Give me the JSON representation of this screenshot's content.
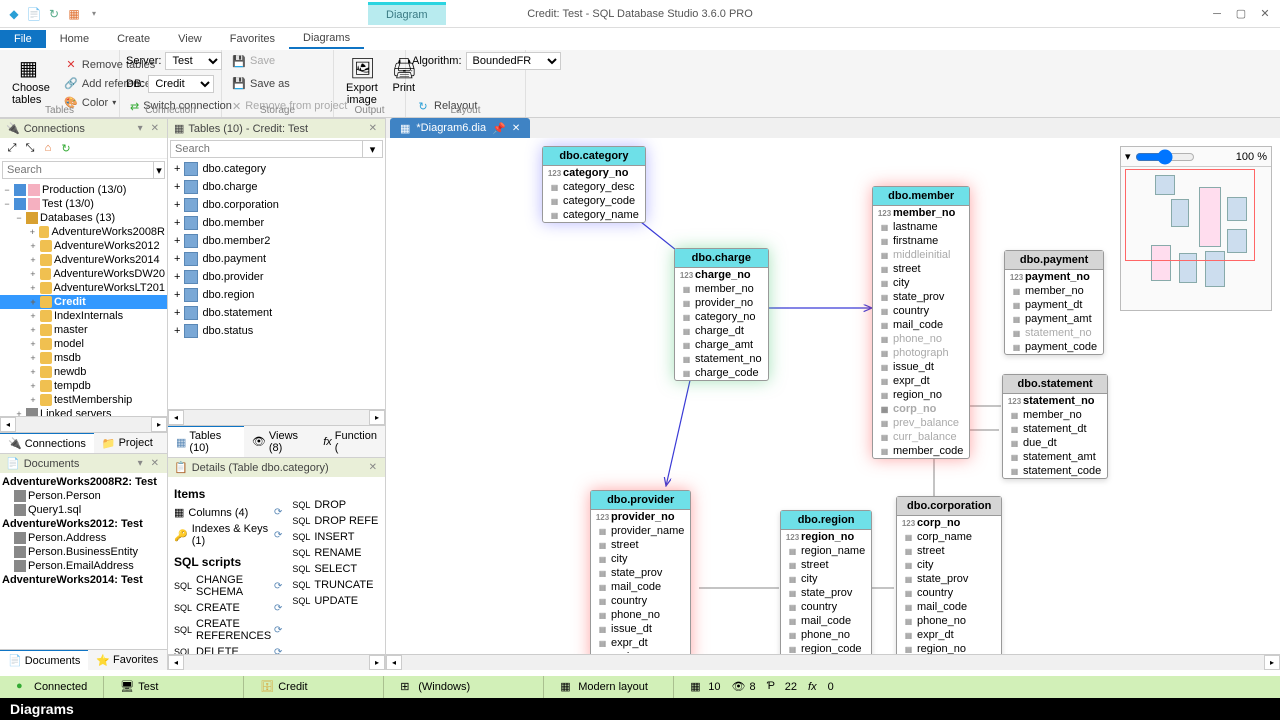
{
  "title": "Credit: Test - SQL Database Studio 3.6.0 PRO",
  "context_tab": "Diagram",
  "ribbon_tabs": {
    "file": "File",
    "home": "Home",
    "create": "Create",
    "view": "View",
    "favorites": "Favorites",
    "diagrams": "Diagrams"
  },
  "ribbon": {
    "choose_tables": "Choose tables",
    "remove_tables": "Remove tables",
    "add_refs": "Add references",
    "color": "Color",
    "server": "Server:",
    "server_val": "Test",
    "db": "DB:",
    "db_val": "Credit",
    "switch_conn": "Switch connection",
    "save": "Save",
    "saveas": "Save as",
    "remove_proj": "Remove from project",
    "export": "Export image",
    "print": "Print",
    "algorithm": "Algorithm:",
    "algo_val": "BoundedFR",
    "relayout": "Relayout",
    "g_tables": "Tables",
    "g_conn": "Connection",
    "g_storage": "Storage",
    "g_output": "Output",
    "g_layout": "Layout"
  },
  "panels": {
    "connections": "Connections",
    "tables_hd": "Tables (10) - Credit: Test",
    "documents": "Documents",
    "details": "Details (Table dbo.category)",
    "search": "Search",
    "tabs_bottom": {
      "tables": "Tables (10)",
      "views": "Views (8)",
      "function": "Function (",
      "connections": "Connections",
      "project": "Project",
      "documents": "Documents",
      "favorites": "Favorites"
    }
  },
  "tree": {
    "prod": "Production (13/0)",
    "test": "Test (13/0)",
    "databases": "Databases (13)",
    "dbs": [
      "AdventureWorks2008R",
      "AdventureWorks2012",
      "AdventureWorks2014",
      "AdventureWorksDW20",
      "AdventureWorksLT201",
      "Credit",
      "IndexInternals",
      "master",
      "model",
      "msdb",
      "newdb",
      "tempdb",
      "testMembership"
    ],
    "linked": "Linked servers"
  },
  "table_list": [
    "dbo.category",
    "dbo.charge",
    "dbo.corporation",
    "dbo.member",
    "dbo.member2",
    "dbo.payment",
    "dbo.provider",
    "dbo.region",
    "dbo.statement",
    "dbo.status"
  ],
  "details": {
    "items": "Items",
    "columns": "Columns (4)",
    "indexes": "Indexes & Keys (1)",
    "sql_scripts": "SQL scripts",
    "change_schema": "CHANGE SCHEMA",
    "create": "CREATE",
    "create_ref": "CREATE REFERENCES",
    "delete": "DELETE",
    "drop": "DROP",
    "drop_ref": "DROP REFE",
    "insert": "INSERT",
    "rename": "RENAME",
    "select": "SELECT",
    "truncate": "TRUNCATE",
    "update": "UPDATE"
  },
  "documents": {
    "g1": "AdventureWorks2008R2: Test",
    "g1_items": [
      "Person.Person",
      "Query1.sql"
    ],
    "g2": "AdventureWorks2012: Test",
    "g2_items": [
      "Person.Address",
      "Person.BusinessEntity",
      "Person.EmailAddress"
    ],
    "g3": "AdventureWorks2014: Test"
  },
  "doc_tab": "*Diagram6.dia",
  "diagram": {
    "category": {
      "name": "dbo.category",
      "cols": [
        "category_no",
        "category_desc",
        "category_code",
        "category_name"
      ]
    },
    "charge": {
      "name": "dbo.charge",
      "cols": [
        "charge_no",
        "member_no",
        "provider_no",
        "category_no",
        "charge_dt",
        "charge_amt",
        "statement_no",
        "charge_code"
      ]
    },
    "member": {
      "name": "dbo.member",
      "cols": [
        "member_no",
        "lastname",
        "firstname",
        "middleinitial",
        "street",
        "city",
        "state_prov",
        "country",
        "mail_code",
        "phone_no",
        "photograph",
        "issue_dt",
        "expr_dt",
        "region_no",
        "corp_no",
        "prev_balance",
        "curr_balance",
        "member_code"
      ]
    },
    "payment": {
      "name": "dbo.payment",
      "cols": [
        "payment_no",
        "member_no",
        "payment_dt",
        "payment_amt",
        "statement_no",
        "payment_code"
      ]
    },
    "statement": {
      "name": "dbo.statement",
      "cols": [
        "statement_no",
        "member_no",
        "statement_dt",
        "due_dt",
        "statement_amt",
        "statement_code"
      ]
    },
    "provider": {
      "name": "dbo.provider",
      "cols": [
        "provider_no",
        "provider_name",
        "street",
        "city",
        "state_prov",
        "mail_code",
        "country",
        "phone_no",
        "issue_dt",
        "expr_dt",
        "region_no"
      ]
    },
    "region": {
      "name": "dbo.region",
      "cols": [
        "region_no",
        "region_name",
        "street",
        "city",
        "state_prov",
        "country",
        "mail_code",
        "phone_no",
        "region_code"
      ]
    },
    "corporation": {
      "name": "dbo.corporation",
      "cols": [
        "corp_no",
        "corp_name",
        "street",
        "city",
        "state_prov",
        "country",
        "mail_code",
        "phone_no",
        "expr_dt",
        "region_no"
      ]
    }
  },
  "zoom": "100 %",
  "status": {
    "connected": "Connected",
    "server": "Test",
    "db": "Credit",
    "os": "(Windows)",
    "layout": "Modern layout",
    "counts": {
      "t": "10",
      "v": "8",
      "p": "22",
      "f": "0"
    }
  },
  "footer": "Diagrams"
}
